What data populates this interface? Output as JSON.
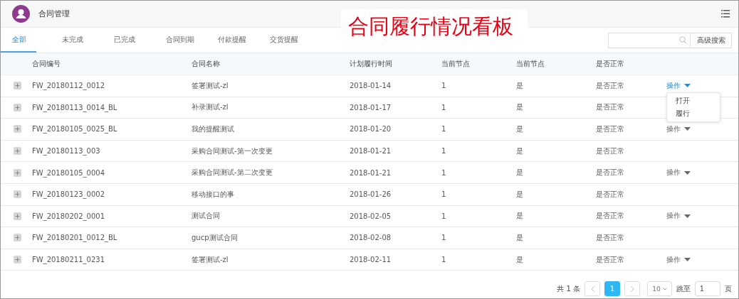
{
  "header": {
    "title": "合同管理"
  },
  "overlay_title": "合同履行情况看板",
  "tabs": [
    {
      "label": "全部",
      "selected": true
    },
    {
      "label": "未完成",
      "selected": false
    },
    {
      "label": "已完成",
      "selected": false
    },
    {
      "label": "合同到期",
      "selected": false
    },
    {
      "label": "付款提醒",
      "selected": false
    },
    {
      "label": "交货提醒",
      "selected": false
    }
  ],
  "search": {
    "button": "高级搜索"
  },
  "table": {
    "columns": [
      "合同编号",
      "合同名称",
      "计划履行时间",
      "当前节点",
      "当前节点",
      "是否正常"
    ],
    "rows": [
      {
        "id": "FW_20180112_0012",
        "name": "签署测试-zl",
        "date": "2018-01-14",
        "node": "1",
        "current": "是",
        "normal": "是否正常",
        "action": "操作",
        "menu_open": true
      },
      {
        "id": "FW_20180113_0014_BL",
        "name": "补录测试-zl",
        "date": "2018-01-17",
        "node": "1",
        "current": "是",
        "normal": "是否正常"
      },
      {
        "id": "FW_20180105_0025_BL",
        "name": "我的提醒测试",
        "date": "2018-01-20",
        "node": "1",
        "current": "是",
        "normal": "是否正常",
        "action": "操作",
        "menu_open": false
      },
      {
        "id": "FW_20180113_003",
        "name": "采购合同测试-第一次变更",
        "date": "2018-01-21",
        "node": "1",
        "current": "是",
        "normal": "是否正常"
      },
      {
        "id": "FW_20180105_0004",
        "name": "采购合同测试-第二次变更",
        "date": "2018-01-21",
        "node": "1",
        "current": "是",
        "normal": "是否正常",
        "action": "操作",
        "menu_open": false
      },
      {
        "id": "FW_20180123_0002",
        "name": "移动接口的事",
        "date": "2018-01-26",
        "node": "1",
        "current": "是",
        "normal": "是否正常"
      },
      {
        "id": "FW_20180202_0001",
        "name": "测试合同",
        "date": "2018-02-05",
        "node": "1",
        "current": "是",
        "normal": "是否正常",
        "action": "操作",
        "menu_open": false
      },
      {
        "id": "FW_20180201_0012_BL",
        "name": "gucp测试合同",
        "date": "2018-02-08",
        "node": "1",
        "current": "是",
        "normal": "是否正常"
      },
      {
        "id": "FW_20180211_0231",
        "name": "签署测试-zl",
        "date": "2018-02-11",
        "node": "1",
        "current": "是",
        "normal": "是否正常",
        "action": "操作",
        "menu_open": false
      }
    ]
  },
  "action_menu": [
    "打开",
    "履行"
  ],
  "pagination": {
    "total": "共 1 条",
    "pages": [
      {
        "label": "1",
        "selected": true
      }
    ],
    "page_size": "10",
    "jump_label": "跳至",
    "jump_value": "1",
    "page_suffix": "页"
  }
}
